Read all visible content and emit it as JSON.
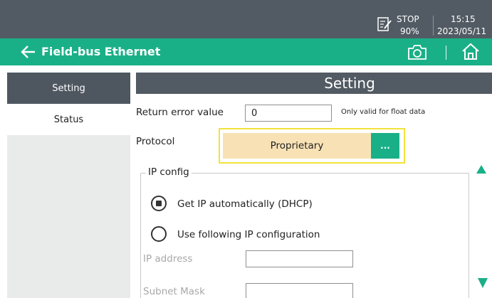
{
  "status_bar": {
    "state": "STOP",
    "battery": "90%",
    "time": "15:15",
    "date": "2023/05/11"
  },
  "title_bar": {
    "title": "Field-bus Ethernet"
  },
  "nav": {
    "items": [
      {
        "label": "Setting",
        "active": true
      },
      {
        "label": "Status",
        "active": false
      }
    ]
  },
  "main": {
    "header": "Setting",
    "return_error": {
      "label": "Return error value",
      "value": "0",
      "note": "Only valid for float data"
    },
    "protocol": {
      "label": "Protocol",
      "value": "Proprietary",
      "more_label": "..."
    },
    "ip_config": {
      "title": "IP config",
      "options": [
        {
          "label": "Get IP automatically (DHCP)",
          "selected": true
        },
        {
          "label": "Use following IP configuration",
          "selected": false
        }
      ],
      "ip_address_label": "IP address",
      "ip_address_value": "",
      "subnet_mask_label": "Subnet Mask",
      "subnet_mask_value": ""
    }
  },
  "colors": {
    "accent_green": "#1ab087",
    "header_gray": "#525b63",
    "highlight_yellow": "#f1e33a",
    "protocol_bg": "#f8e2b5"
  }
}
